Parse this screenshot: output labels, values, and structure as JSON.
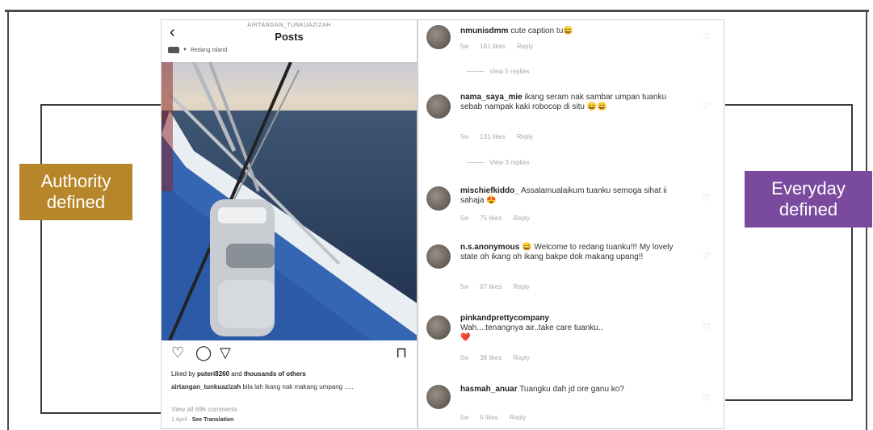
{
  "labels": {
    "authority": "Authority\ndefined",
    "authority_color": "#b8862a",
    "everyday": "Everyday\ndefined",
    "everyday_color": "#7a4a9e"
  },
  "post": {
    "account_header": "AIRTANGAN_TUNKUAZIZAH",
    "title": "Posts",
    "location": "Redang Island",
    "liked_by_prefix": "Liked by ",
    "liked_by_user": "puteri8260",
    "liked_by_middle": " and ",
    "liked_by_others": "thousands of others",
    "caption_user": "airtangan_tunkuazizah",
    "caption_text": " bila lah ikang nak makang umpang .....",
    "view_comments": "View all 696 comments",
    "time": "1 April",
    "see_translation": "See Translation"
  },
  "comments": [
    {
      "user": "nmunisdmm",
      "text": " cute caption tu",
      "emoji": "😄",
      "time": "5w",
      "likes": "161 likes",
      "reply": "Reply"
    },
    {
      "user": "nama_saya_mie",
      "text": " ikang seram nak sambar umpan tuanku sebab nampak kaki robocop di situ ",
      "emoji": "😄😄",
      "time": "5w",
      "likes": "131 likes",
      "reply": "Reply"
    },
    {
      "user": "mischiefkiddo_",
      "text": " Assalamualaikum tuanku semoga sihat ii sahaja ",
      "emoji": "😍",
      "time": "5w",
      "likes": "75 likes",
      "reply": "Reply"
    },
    {
      "user": "n.s.anonymous",
      "text": " Welcome to redang tuanku!!! My lovely state  oh ikang oh ikang bakpe dok makang upang!!",
      "emoji": "😄",
      "time": "5w",
      "likes": "67 likes",
      "reply": "Reply"
    },
    {
      "user": "pinkandprettycompany",
      "text": "Wah....tenangnya air..take care tuanku..",
      "emoji": "❤️",
      "time": "5w",
      "likes": "38 likes",
      "reply": "Reply"
    },
    {
      "user": "hasmah_anuar",
      "text": " Tuangku dah jd ore ganu ko?",
      "emoji": "",
      "time": "5w",
      "likes": "5 likes",
      "reply": "Reply"
    }
  ],
  "replies": [
    "View 5 replies",
    "View 3 replies"
  ],
  "icons": [
    "back-icon",
    "heart-icon",
    "comment-icon",
    "share-icon",
    "bookmark-icon"
  ]
}
